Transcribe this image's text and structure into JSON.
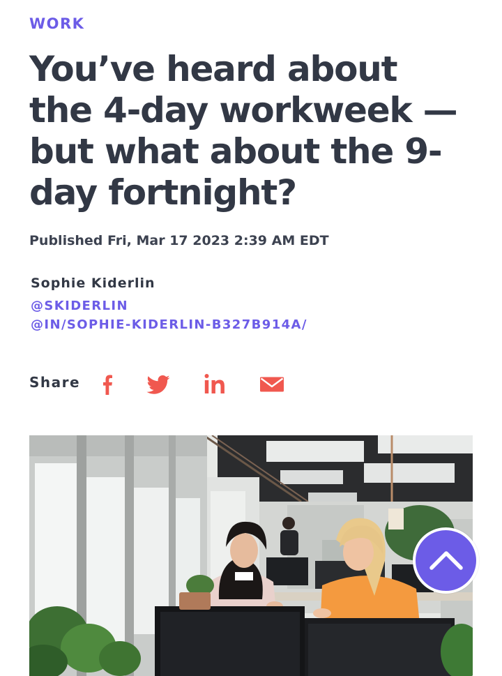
{
  "article": {
    "category": "WORK",
    "headline": "You’ve heard about the 4-day workweek — but what about the 9-day fortnight?",
    "published": "Published Fri, Mar 17 2023 2:39 AM EDT",
    "author": {
      "name": "Sophie Kiderlin",
      "twitter": "@SKIDERLIN",
      "linkedin": "@IN/SOPHIE-KIDERLIN-B327B914A/"
    }
  },
  "share": {
    "label": "Share",
    "icons": [
      "facebook-icon",
      "twitter-icon",
      "linkedin-icon",
      "email-icon"
    ]
  },
  "colors": {
    "accent": "#6c5ce7",
    "text": "#323845",
    "share_icon": "#f0584f"
  },
  "scroll_top": {
    "icon": "chevron-up-icon"
  }
}
